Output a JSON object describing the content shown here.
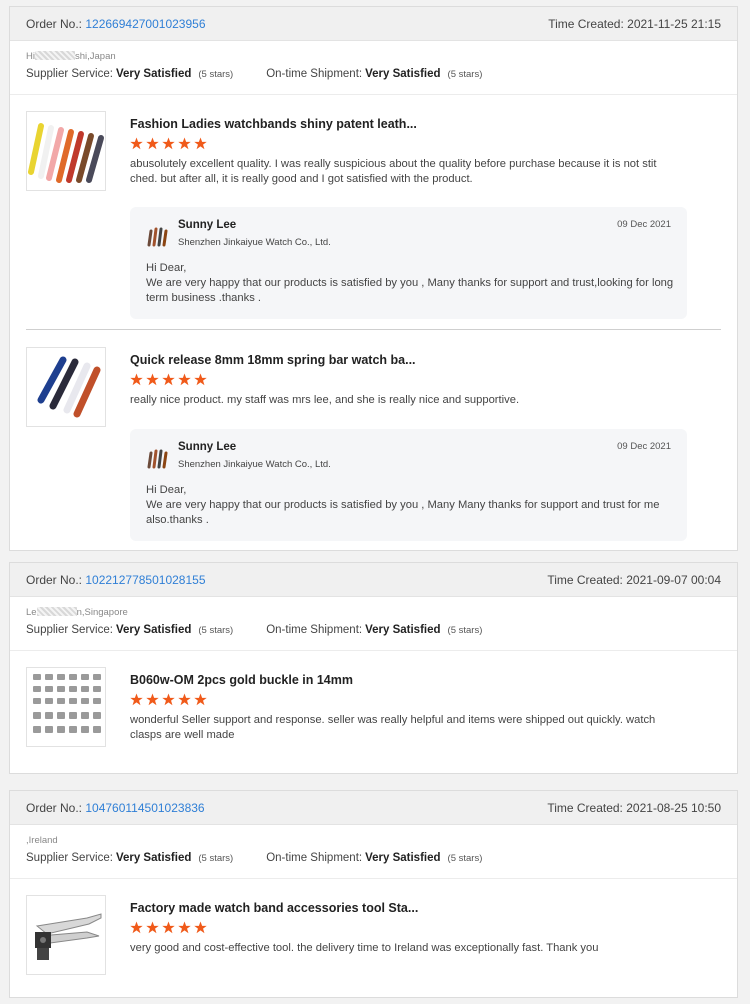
{
  "colors": {
    "accent_link": "#2f7fd6",
    "star": "#f05a1a",
    "header_bg": "#f0f0f0"
  },
  "labels": {
    "order_no": "Order No.:",
    "time_created": "Time Created:",
    "supplier_service": "Supplier Service:",
    "ontime_shipment": "On-time Shipment:"
  },
  "orders": [
    {
      "order_no": "122669427001023956",
      "time_created": "2021-11-25 21:15",
      "buyer_prefix": "Hi",
      "buyer_suffix": "shi,Japan",
      "supplier_rating": "Very Satisfied",
      "supplier_stars": "(5 stars)",
      "shipment_rating": "Very Satisfied",
      "shipment_stars": "(5 stars)",
      "items": [
        {
          "product_name": "Fashion Ladies watchbands shiny patent leath...",
          "rating": 5,
          "comment": "abusolutely excellent quality. I was really suspicious about the quality before purchase because it is not stit ched. but after all, it is really good and I got satisfied with the product.",
          "reply": {
            "name": "Sunny Lee",
            "company": "Shenzhen Jinkaiyue Watch Co., Ltd.",
            "date": "09 Dec 2021",
            "text": "Hi Dear,\nWe are very happy that our products is satisfied by you , Many thanks for support and trust,looking for long term business .thanks ."
          }
        },
        {
          "product_name": "Quick release 8mm 18mm spring bar watch ba...",
          "rating": 5,
          "comment": "really nice product. my staff was mrs lee, and she is really nice and supportive.",
          "reply": {
            "name": "Sunny Lee",
            "company": "Shenzhen Jinkaiyue Watch Co., Ltd.",
            "date": "09 Dec 2021",
            "text": "Hi Dear,\nWe are very happy that our products is satisfied by you , Many Many thanks for support and trust for me also.thanks ."
          }
        }
      ]
    },
    {
      "order_no": "102212778501028155",
      "time_created": "2021-09-07 00:04",
      "buyer_prefix": "Le",
      "buyer_suffix": "n,Singapore",
      "supplier_rating": "Very Satisfied",
      "supplier_stars": "(5 stars)",
      "shipment_rating": "Very Satisfied",
      "shipment_stars": "(5 stars)",
      "items": [
        {
          "product_name": "B060w-OM 2pcs gold buckle in 14mm",
          "rating": 5,
          "comment": "wonderful Seller support and response. seller was really helpful and items were shipped out quickly. watch clasps are well made"
        }
      ]
    },
    {
      "order_no": "104760114501023836",
      "time_created": "2021-08-25 10:50",
      "buyer_prefix": "",
      "buyer_suffix": ",Ireland",
      "supplier_rating": "Very Satisfied",
      "supplier_stars": "(5 stars)",
      "shipment_rating": "Very Satisfied",
      "shipment_stars": "(5 stars)",
      "items": [
        {
          "product_name": "Factory made watch band accessories tool Sta...",
          "rating": 5,
          "comment": "very good and cost-effective tool. the delivery time to Ireland was exceptionally fast. Thank you"
        }
      ]
    }
  ]
}
